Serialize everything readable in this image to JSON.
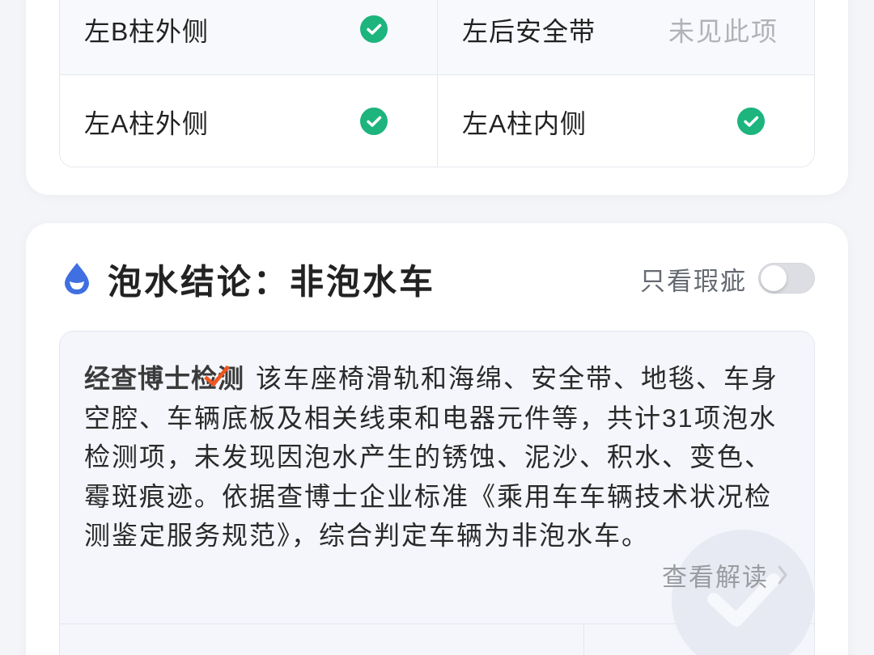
{
  "check_grid": {
    "items": [
      {
        "label": "左B柱外侧",
        "kind": "pass"
      },
      {
        "label": "左后安全带",
        "kind": "note",
        "note": "未见此项"
      },
      {
        "label": "左A柱外侧",
        "kind": "pass"
      },
      {
        "label": "左A柱内侧",
        "kind": "pass"
      }
    ]
  },
  "flood_section": {
    "title": "泡水结论：非泡水车",
    "filter_toggle": {
      "label": "只看瑕疵",
      "on": false
    },
    "report": {
      "brand": "经查博士检测",
      "text": "该车座椅滑轨和海绵、安全带、地毯、车身空腔、车辆底板及相关线束和电器元件等，共计31项泡水检测项，未发现因泡水产生的锈蚀、泥沙、积水、变色、霉斑痕迹。依据查博士企业标准《乘用车车辆技术状况检测鉴定服务规范》，综合判定车辆为非泡水车。",
      "link": "查看解读"
    }
  }
}
